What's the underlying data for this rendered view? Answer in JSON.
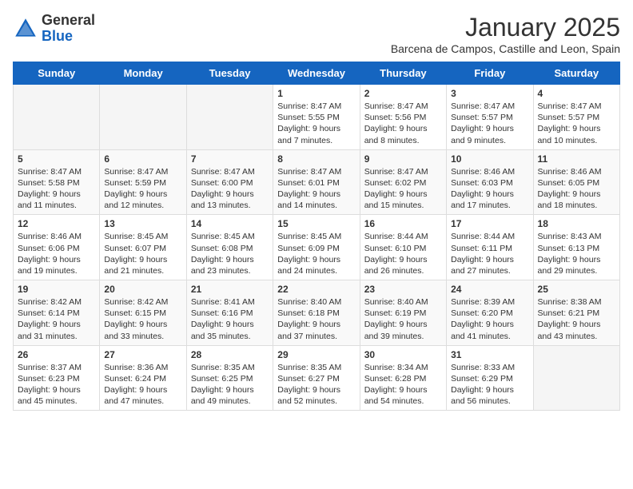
{
  "header": {
    "logo": {
      "general": "General",
      "blue": "Blue"
    },
    "title": "January 2025",
    "subtitle": "Barcena de Campos, Castille and Leon, Spain"
  },
  "weekdays": [
    "Sunday",
    "Monday",
    "Tuesday",
    "Wednesday",
    "Thursday",
    "Friday",
    "Saturday"
  ],
  "weeks": [
    [
      {
        "day": "",
        "empty": true
      },
      {
        "day": "",
        "empty": true
      },
      {
        "day": "",
        "empty": true
      },
      {
        "day": "1",
        "sunrise": "Sunrise: 8:47 AM",
        "sunset": "Sunset: 5:55 PM",
        "daylight": "Daylight: 9 hours and 7 minutes."
      },
      {
        "day": "2",
        "sunrise": "Sunrise: 8:47 AM",
        "sunset": "Sunset: 5:56 PM",
        "daylight": "Daylight: 9 hours and 8 minutes."
      },
      {
        "day": "3",
        "sunrise": "Sunrise: 8:47 AM",
        "sunset": "Sunset: 5:57 PM",
        "daylight": "Daylight: 9 hours and 9 minutes."
      },
      {
        "day": "4",
        "sunrise": "Sunrise: 8:47 AM",
        "sunset": "Sunset: 5:57 PM",
        "daylight": "Daylight: 9 hours and 10 minutes."
      }
    ],
    [
      {
        "day": "5",
        "sunrise": "Sunrise: 8:47 AM",
        "sunset": "Sunset: 5:58 PM",
        "daylight": "Daylight: 9 hours and 11 minutes."
      },
      {
        "day": "6",
        "sunrise": "Sunrise: 8:47 AM",
        "sunset": "Sunset: 5:59 PM",
        "daylight": "Daylight: 9 hours and 12 minutes."
      },
      {
        "day": "7",
        "sunrise": "Sunrise: 8:47 AM",
        "sunset": "Sunset: 6:00 PM",
        "daylight": "Daylight: 9 hours and 13 minutes."
      },
      {
        "day": "8",
        "sunrise": "Sunrise: 8:47 AM",
        "sunset": "Sunset: 6:01 PM",
        "daylight": "Daylight: 9 hours and 14 minutes."
      },
      {
        "day": "9",
        "sunrise": "Sunrise: 8:47 AM",
        "sunset": "Sunset: 6:02 PM",
        "daylight": "Daylight: 9 hours and 15 minutes."
      },
      {
        "day": "10",
        "sunrise": "Sunrise: 8:46 AM",
        "sunset": "Sunset: 6:03 PM",
        "daylight": "Daylight: 9 hours and 17 minutes."
      },
      {
        "day": "11",
        "sunrise": "Sunrise: 8:46 AM",
        "sunset": "Sunset: 6:05 PM",
        "daylight": "Daylight: 9 hours and 18 minutes."
      }
    ],
    [
      {
        "day": "12",
        "sunrise": "Sunrise: 8:46 AM",
        "sunset": "Sunset: 6:06 PM",
        "daylight": "Daylight: 9 hours and 19 minutes."
      },
      {
        "day": "13",
        "sunrise": "Sunrise: 8:45 AM",
        "sunset": "Sunset: 6:07 PM",
        "daylight": "Daylight: 9 hours and 21 minutes."
      },
      {
        "day": "14",
        "sunrise": "Sunrise: 8:45 AM",
        "sunset": "Sunset: 6:08 PM",
        "daylight": "Daylight: 9 hours and 23 minutes."
      },
      {
        "day": "15",
        "sunrise": "Sunrise: 8:45 AM",
        "sunset": "Sunset: 6:09 PM",
        "daylight": "Daylight: 9 hours and 24 minutes."
      },
      {
        "day": "16",
        "sunrise": "Sunrise: 8:44 AM",
        "sunset": "Sunset: 6:10 PM",
        "daylight": "Daylight: 9 hours and 26 minutes."
      },
      {
        "day": "17",
        "sunrise": "Sunrise: 8:44 AM",
        "sunset": "Sunset: 6:11 PM",
        "daylight": "Daylight: 9 hours and 27 minutes."
      },
      {
        "day": "18",
        "sunrise": "Sunrise: 8:43 AM",
        "sunset": "Sunset: 6:13 PM",
        "daylight": "Daylight: 9 hours and 29 minutes."
      }
    ],
    [
      {
        "day": "19",
        "sunrise": "Sunrise: 8:42 AM",
        "sunset": "Sunset: 6:14 PM",
        "daylight": "Daylight: 9 hours and 31 minutes."
      },
      {
        "day": "20",
        "sunrise": "Sunrise: 8:42 AM",
        "sunset": "Sunset: 6:15 PM",
        "daylight": "Daylight: 9 hours and 33 minutes."
      },
      {
        "day": "21",
        "sunrise": "Sunrise: 8:41 AM",
        "sunset": "Sunset: 6:16 PM",
        "daylight": "Daylight: 9 hours and 35 minutes."
      },
      {
        "day": "22",
        "sunrise": "Sunrise: 8:40 AM",
        "sunset": "Sunset: 6:18 PM",
        "daylight": "Daylight: 9 hours and 37 minutes."
      },
      {
        "day": "23",
        "sunrise": "Sunrise: 8:40 AM",
        "sunset": "Sunset: 6:19 PM",
        "daylight": "Daylight: 9 hours and 39 minutes."
      },
      {
        "day": "24",
        "sunrise": "Sunrise: 8:39 AM",
        "sunset": "Sunset: 6:20 PM",
        "daylight": "Daylight: 9 hours and 41 minutes."
      },
      {
        "day": "25",
        "sunrise": "Sunrise: 8:38 AM",
        "sunset": "Sunset: 6:21 PM",
        "daylight": "Daylight: 9 hours and 43 minutes."
      }
    ],
    [
      {
        "day": "26",
        "sunrise": "Sunrise: 8:37 AM",
        "sunset": "Sunset: 6:23 PM",
        "daylight": "Daylight: 9 hours and 45 minutes."
      },
      {
        "day": "27",
        "sunrise": "Sunrise: 8:36 AM",
        "sunset": "Sunset: 6:24 PM",
        "daylight": "Daylight: 9 hours and 47 minutes."
      },
      {
        "day": "28",
        "sunrise": "Sunrise: 8:35 AM",
        "sunset": "Sunset: 6:25 PM",
        "daylight": "Daylight: 9 hours and 49 minutes."
      },
      {
        "day": "29",
        "sunrise": "Sunrise: 8:35 AM",
        "sunset": "Sunset: 6:27 PM",
        "daylight": "Daylight: 9 hours and 52 minutes."
      },
      {
        "day": "30",
        "sunrise": "Sunrise: 8:34 AM",
        "sunset": "Sunset: 6:28 PM",
        "daylight": "Daylight: 9 hours and 54 minutes."
      },
      {
        "day": "31",
        "sunrise": "Sunrise: 8:33 AM",
        "sunset": "Sunset: 6:29 PM",
        "daylight": "Daylight: 9 hours and 56 minutes."
      },
      {
        "day": "",
        "empty": true
      }
    ]
  ]
}
